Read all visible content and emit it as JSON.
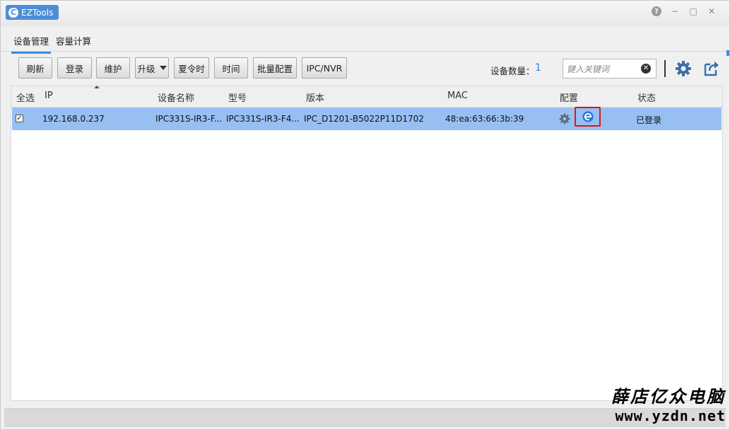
{
  "app": {
    "title": "EZTools"
  },
  "window_controls": {
    "help": "?",
    "minimize": "−",
    "maximize": "□",
    "close": "✕"
  },
  "tabs": [
    {
      "label": "设备管理",
      "active": true
    },
    {
      "label": "容量计算",
      "active": false
    }
  ],
  "toolbar": {
    "buttons": [
      "刷新",
      "登录",
      "维护",
      "升级",
      "夏令时",
      "时间",
      "批量配置",
      "IPC/NVR"
    ],
    "device_count_label": "设备数量：",
    "device_count": "1",
    "search_placeholder": "键入关键词"
  },
  "table": {
    "headers": [
      "全选",
      "IP",
      "设备名称",
      "型号",
      "版本",
      "MAC",
      "配置",
      "状态"
    ],
    "rows": [
      {
        "checked": true,
        "ip": "192.168.0.237",
        "device_name": "IPC331S-IR3-F...",
        "model": "IPC331S-IR3-F4...",
        "version": "IPC_D1201-B5022P11D1702",
        "mac": "48:ea:63:66:3b:39",
        "status": "已登录"
      }
    ]
  },
  "watermark": {
    "text_cn": "薛店亿众电脑",
    "url": "www.yzdn.net"
  },
  "colors": {
    "accent": "#3d8de0",
    "selected_row": "#97bff2",
    "highlight_box": "#e01515"
  }
}
